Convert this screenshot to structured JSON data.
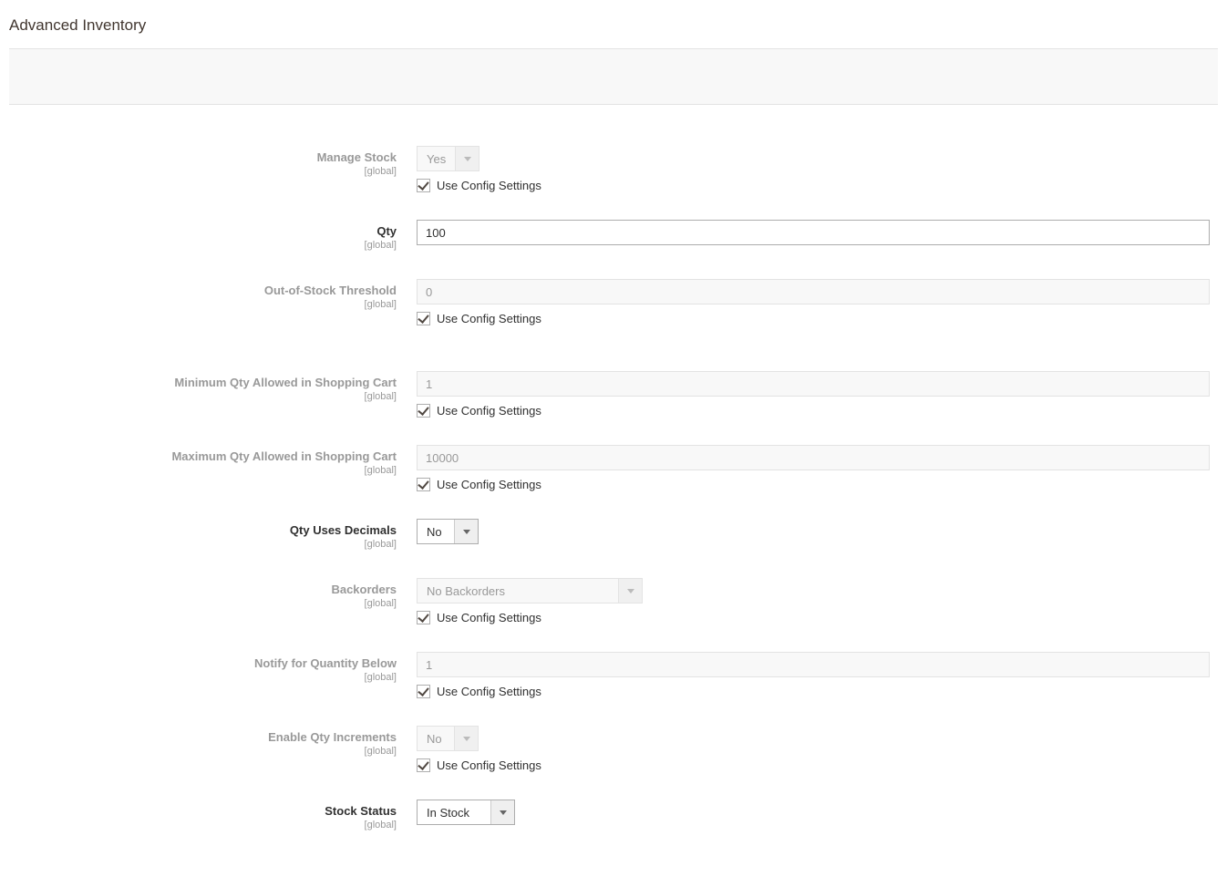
{
  "page_title": "Advanced Inventory",
  "use_config_label": "Use Config Settings",
  "scope_global": "[global]",
  "fields": {
    "manage_stock": {
      "label": "Manage Stock",
      "value": "Yes",
      "disabled": true,
      "use_config": true
    },
    "qty": {
      "label": "Qty",
      "value": "100"
    },
    "out_of_stock_threshold": {
      "label": "Out-of-Stock Threshold",
      "value": "0",
      "disabled": true,
      "use_config": true
    },
    "min_qty": {
      "label": "Minimum Qty Allowed in Shopping Cart",
      "value": "1",
      "disabled": true,
      "use_config": true
    },
    "max_qty": {
      "label": "Maximum Qty Allowed in Shopping Cart",
      "value": "10000",
      "disabled": true,
      "use_config": true
    },
    "qty_decimals": {
      "label": "Qty Uses Decimals",
      "value": "No"
    },
    "backorders": {
      "label": "Backorders",
      "value": "No Backorders",
      "disabled": true,
      "use_config": true
    },
    "notify_below": {
      "label": "Notify for Quantity Below",
      "value": "1",
      "disabled": true,
      "use_config": true
    },
    "enable_increments": {
      "label": "Enable Qty Increments",
      "value": "No",
      "disabled": true,
      "use_config": true
    },
    "stock_status": {
      "label": "Stock Status",
      "value": "In Stock"
    }
  }
}
